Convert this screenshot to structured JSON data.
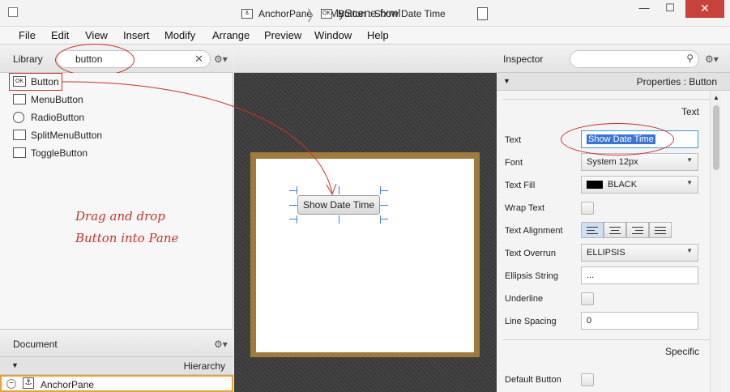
{
  "window": {
    "title": "MyScene.fxml",
    "minimize": "—",
    "maximize": "☐",
    "close": "✕"
  },
  "menu": [
    "File",
    "Edit",
    "View",
    "Insert",
    "Modify",
    "Arrange",
    "Preview",
    "Window",
    "Help"
  ],
  "library": {
    "title": "Library",
    "search_value": "button",
    "clear": "✕",
    "gear": "⚙▾",
    "items": [
      {
        "label": "Button",
        "icon": "OK"
      },
      {
        "label": "MenuButton",
        "icon": ""
      },
      {
        "label": "RadioButton",
        "icon": ""
      },
      {
        "label": "SplitMenuButton",
        "icon": ""
      },
      {
        "label": "ToggleButton",
        "icon": ""
      }
    ]
  },
  "document": {
    "title": "Document",
    "gear": "⚙▾",
    "hierarchy_label": "Hierarchy",
    "root_item": "AnchorPane"
  },
  "content": {
    "breadcrumb_1": "AnchorPane",
    "breadcrumb_2": "Button : Show Date Time",
    "ok_icon": "OK",
    "button_text": "Show Date Time",
    "annotation_line1": "Drag and drop",
    "annotation_line2": "Button into Pane"
  },
  "inspector": {
    "title": "Inspector",
    "gear": "⚙▾",
    "search_icon": "⚲",
    "properties_label": "Properties : Button",
    "section_text": "Text",
    "section_specific": "Specific",
    "props": {
      "text_label": "Text",
      "text_value": "Show Date Time",
      "font_label": "Font",
      "font_value": "System 12px",
      "fill_label": "Text Fill",
      "fill_value": "BLACK",
      "wrap_label": "Wrap Text",
      "align_label": "Text Alignment",
      "overrun_label": "Text Overrun",
      "overrun_value": "ELLIPSIS",
      "ellipsis_label": "Ellipsis String",
      "ellipsis_value": "...",
      "underline_label": "Underline",
      "spacing_label": "Line Spacing",
      "spacing_value": "0",
      "default_label": "Default Button"
    }
  },
  "colors": {
    "annotation": "#c8322a",
    "pane_border": "#a07a3a",
    "selection": "#3875d7",
    "close_button": "#c7423a"
  }
}
